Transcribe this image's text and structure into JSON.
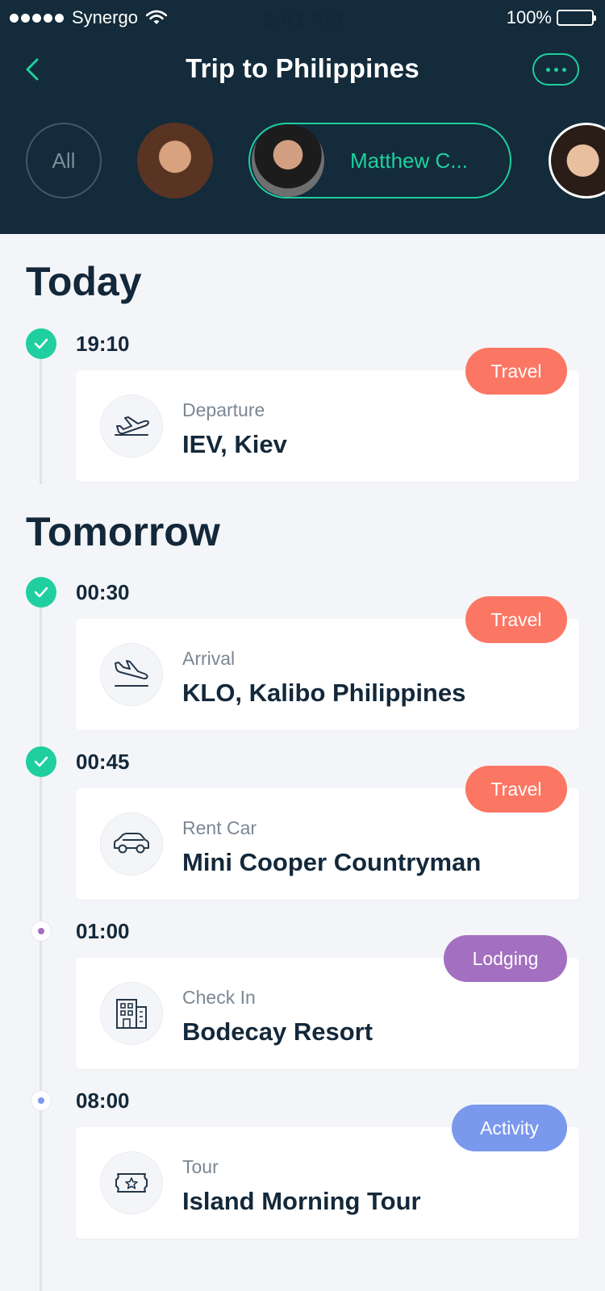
{
  "status_bar": {
    "carrier": "Synergo",
    "time": "9:41 AM",
    "battery": "100%"
  },
  "header": {
    "title": "Trip to Philippines"
  },
  "people": {
    "all_label": "All",
    "selected_name": "Matthew C..."
  },
  "sections": {
    "today": "Today",
    "tomorrow": "Tomorrow"
  },
  "events": [
    {
      "time": "19:10",
      "label": "Departure",
      "value": "IEV, Kiev",
      "tag": "Travel",
      "icon": "plane-departure-icon",
      "status": "done"
    },
    {
      "time": "00:30",
      "label": "Arrival",
      "value": "KLO, Kalibo Philippines",
      "tag": "Travel",
      "icon": "plane-arrival-icon",
      "status": "done"
    },
    {
      "time": "00:45",
      "label": "Rent Car",
      "value": "Mini Cooper Countryman",
      "tag": "Travel",
      "icon": "car-icon",
      "status": "done"
    },
    {
      "time": "01:00",
      "label": "Check In",
      "value": "Bodecay Resort",
      "tag": "Lodging",
      "icon": "hotel-icon",
      "status": "upcoming"
    },
    {
      "time": "08:00",
      "label": "Tour",
      "value": "Island Morning Tour",
      "tag": "Activity",
      "icon": "ticket-icon",
      "status": "upcoming"
    }
  ],
  "colors": {
    "header_bg": "#132b3a",
    "accent": "#1fcf9f",
    "travel": "#fc7664",
    "lodging": "#a36fc0",
    "activity": "#7a98ec"
  }
}
